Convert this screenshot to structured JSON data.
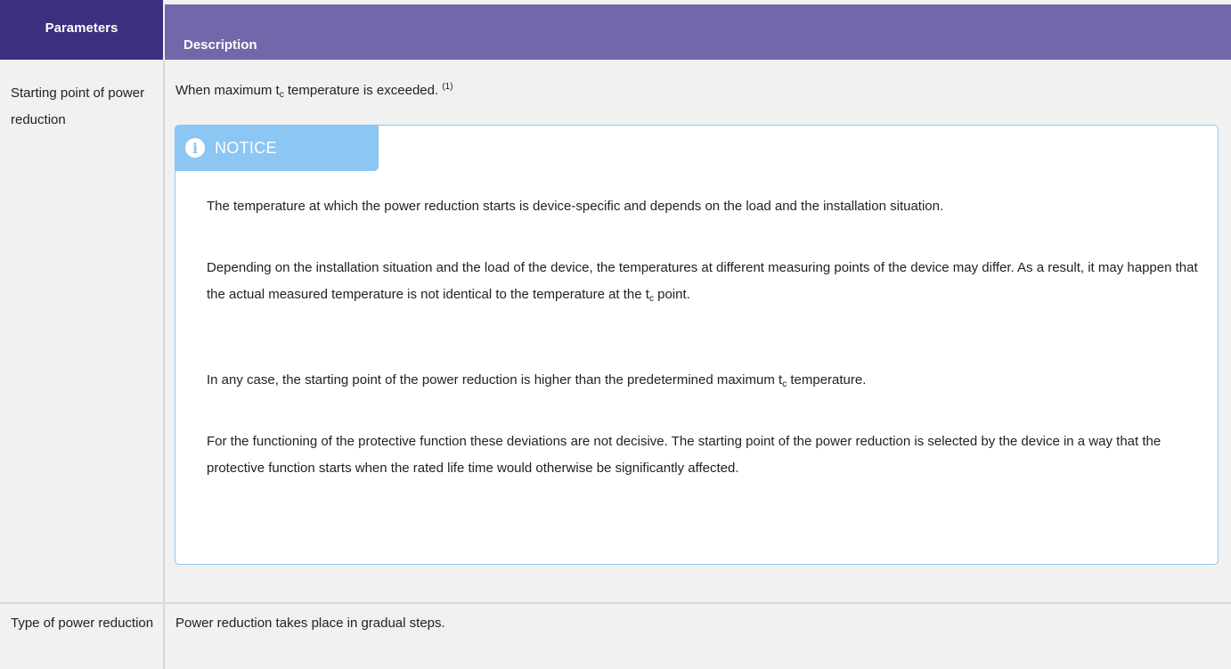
{
  "header": {
    "parameters": "Parameters",
    "description": "Description"
  },
  "rows": [
    {
      "parameter": "Starting point of power reduction",
      "description": {
        "before": "When maximum t",
        "sub": "c",
        "after": " temperature is exceeded. ",
        "footnote": "(1)"
      }
    },
    {
      "parameter": "Type of power reduction",
      "description": "Power reduction takes place in gradual steps."
    }
  ],
  "notice": {
    "icon": "info-icon",
    "title": "NOTICE",
    "p1": "The temperature at which the power reduction starts is device-specific and depends on the load and the installation situation.",
    "p2_before": "Depending on the installation situation and the load of the device, the temperatures at different measuring points of the device may differ. As a result, it may happen that the actual measured temperature is not identical to the temperature at the t",
    "p2_sub": "c",
    "p2_after": " point.",
    "p3_before": "In any case, the starting point of the power reduction is higher than the predetermined maximum t",
    "p3_sub": "c",
    "p3_after": " temperature.",
    "p4": "For the functioning of the protective function these deviations are not decisive. The starting point of the power reduction is selected by the device in a way that the protective function starts when the rated life time would otherwise be significantly affected."
  },
  "colors": {
    "header_dark": "#3c2f7e",
    "header_light": "#7466aa",
    "notice_accent": "#8cc6f2",
    "row_background": "#f1f1f1"
  }
}
